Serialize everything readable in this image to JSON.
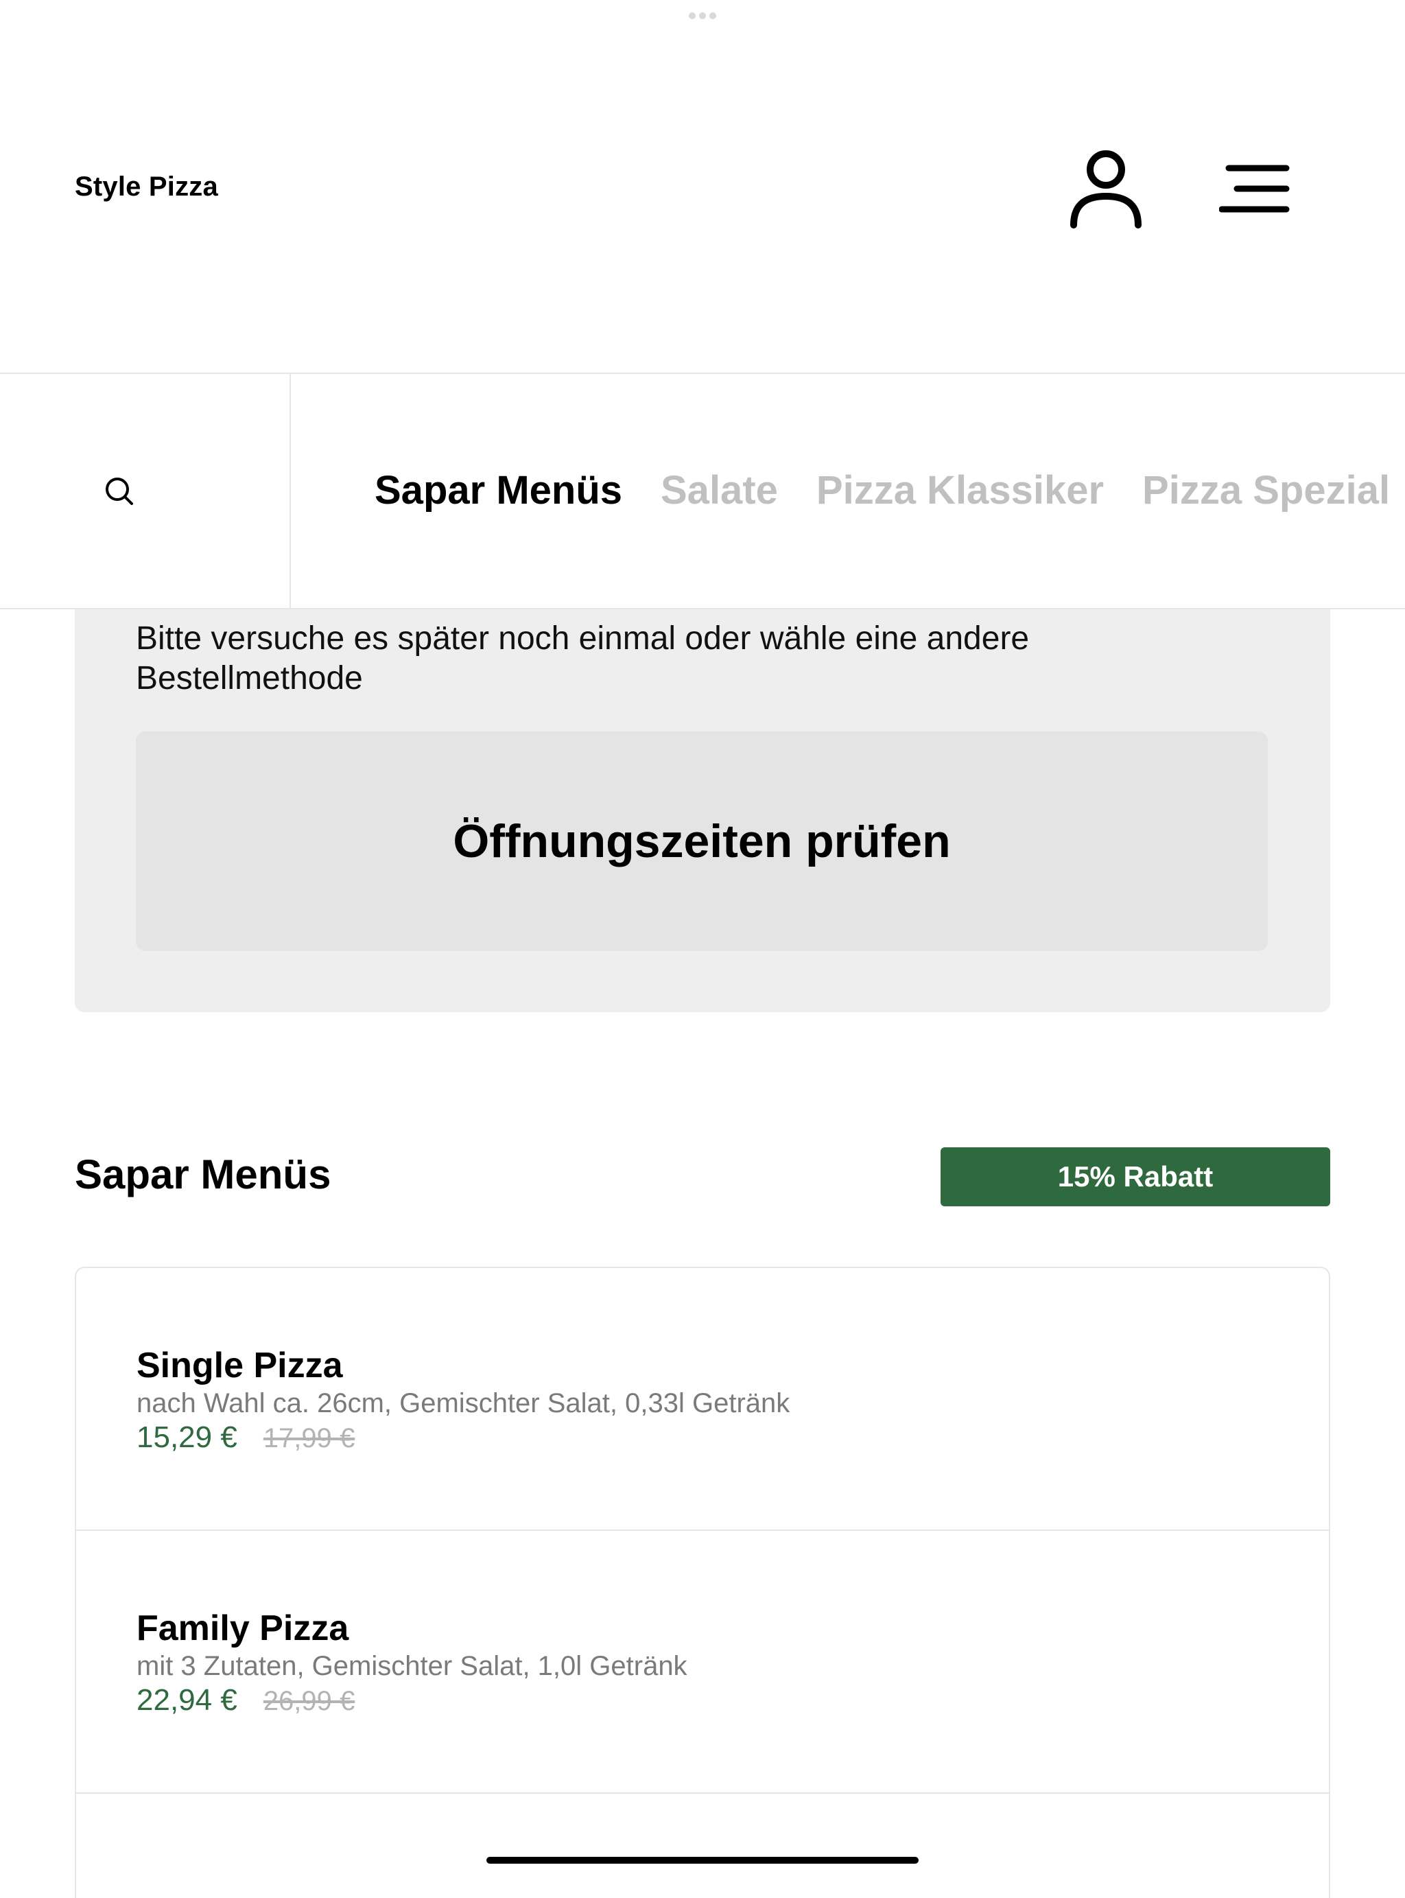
{
  "header": {
    "brand": "Style Pizza"
  },
  "icons": {
    "user": "user-icon",
    "menu": "menu-icon",
    "search": "search-icon"
  },
  "tabs": [
    {
      "label": "Sapar Menüs",
      "active": true
    },
    {
      "label": "Salate",
      "active": false
    },
    {
      "label": "Pizza Klassiker",
      "active": false
    },
    {
      "label": "Pizza Spezial",
      "active": false
    }
  ],
  "notice": {
    "message": "Bitte versuche es später noch einmal oder wähle eine andere Bestellmethode",
    "button_label": "Öffnungszeiten prüfen"
  },
  "section": {
    "title": "Sapar Menüs",
    "badge": "15% Rabatt"
  },
  "products": [
    {
      "name": "Single Pizza",
      "description": "nach Wahl ca. 26cm, Gemischter Salat, 0,33l Getränk",
      "price": "15,29 €",
      "old_price": "17,99 €"
    },
    {
      "name": "Family Pizza",
      "description": "mit 3 Zutaten, Gemischter Salat, 1,0l Getränk",
      "price": "22,94 €",
      "old_price": "26,99 €"
    }
  ],
  "colors": {
    "accent": "#2e6a3e",
    "inactive_tab": "#c0c0c0",
    "card_bg": "#eeeeee",
    "button_bg": "#e4e4e4"
  }
}
